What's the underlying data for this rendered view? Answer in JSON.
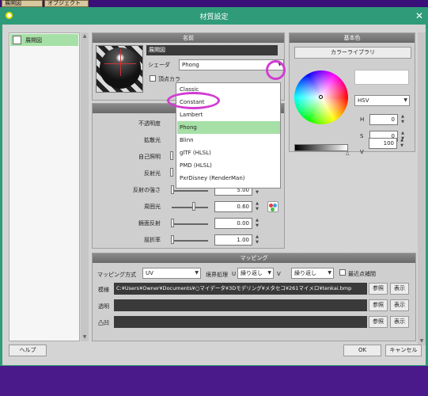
{
  "top_tabs": [
    "展開図",
    "オブジェクト"
  ],
  "window": {
    "title": "材質設定"
  },
  "left_list": {
    "item_label": "展開図"
  },
  "name_panel": {
    "header": "名前",
    "name_value": "展開図",
    "shader_label": "シェーダ",
    "shader_value": "Phong",
    "vertex_color_label": "頂点カラ"
  },
  "shader_dropdown": {
    "options": [
      "Classic",
      "Constant",
      "Lambert",
      "Phong",
      "Blinn",
      "glTF (HLSL)",
      "PMD (HLSL)",
      "PxrDisney (RenderMan)"
    ],
    "selected": "Phong"
  },
  "params": {
    "rows": [
      {
        "label": "不透明度"
      },
      {
        "label": "拡散光"
      },
      {
        "label": "自己照明"
      },
      {
        "label": "反射光"
      },
      {
        "label": "反射の強さ",
        "value": "5.00",
        "level": 0.0
      },
      {
        "label": "周囲光",
        "value": "0.60",
        "level": 0.6
      },
      {
        "label": "鏡面反射",
        "value": "0.00",
        "level": 0.0
      },
      {
        "label": "屈折率",
        "value": "1.00",
        "level": 0.0
      }
    ]
  },
  "base_color": {
    "header": "基本色",
    "color_library_button": "カラーライブラリ",
    "mode": "HSV",
    "h_label": "H",
    "h_value": "0",
    "s_label": "S",
    "s_value": "0",
    "v_label": "V",
    "v_value": "100"
  },
  "mapping": {
    "header": "マッピング",
    "method_label": "マッピング方式",
    "method_value": "UV",
    "boundary_label": "境界処理",
    "u_label": "U",
    "u_value": "繰り返し",
    "v_label": "V",
    "v_value": "繰り返し",
    "nearest_label": "最近点補間",
    "rows": [
      {
        "label": "模様",
        "path": "C:¥Users¥Owner¥Documents¥○マイデータ¥3Dモデリング¥メタセコ¥261マイメロ¥tenkai.bmp",
        "ref": "参照",
        "show": "表示"
      },
      {
        "label": "透明",
        "path": "",
        "ref": "参照",
        "show": "表示"
      },
      {
        "label": "凸凹",
        "path": "",
        "ref": "参照",
        "show": "表示"
      }
    ]
  },
  "footer": {
    "help": "ヘルプ",
    "ok": "OK",
    "cancel": "キャンセル"
  }
}
